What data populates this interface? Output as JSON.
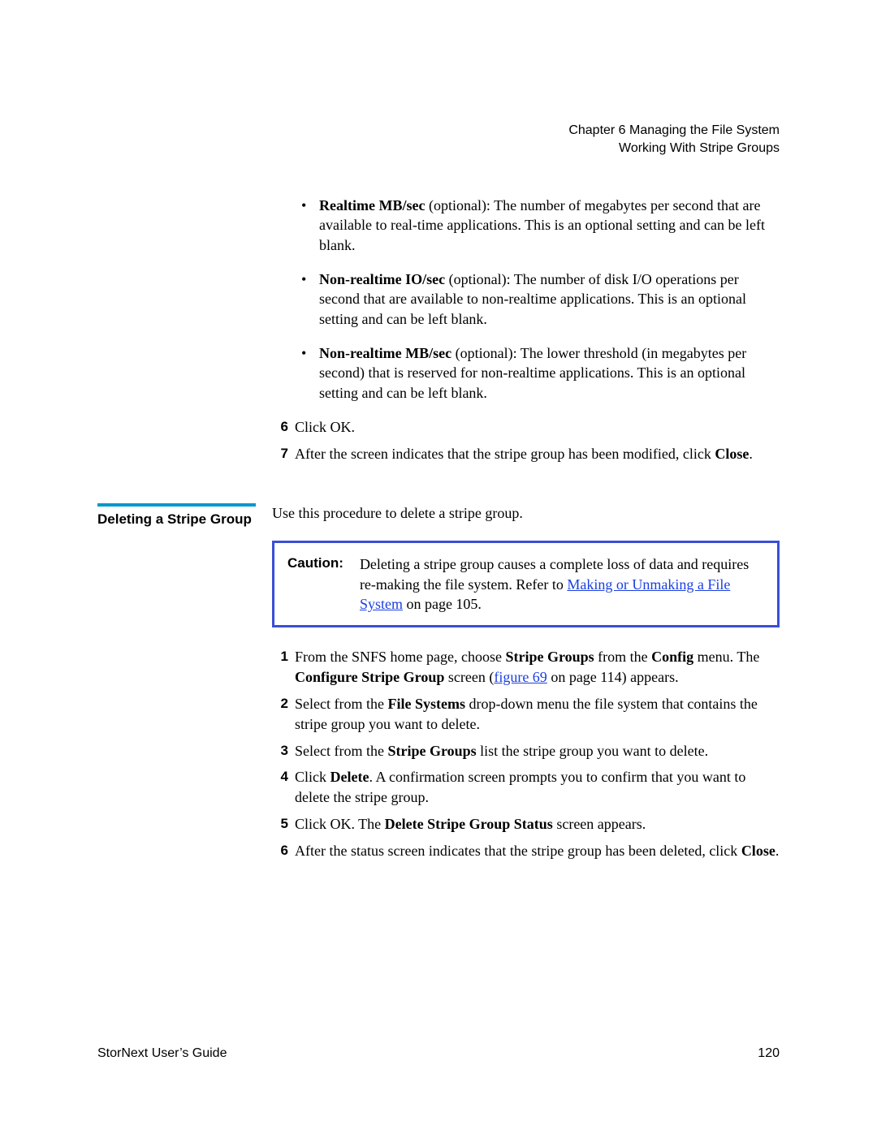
{
  "header": {
    "line1": "Chapter 6  Managing the File System",
    "line2": "Working With Stripe Groups"
  },
  "top_bullets": [
    {
      "bold": "Realtime MB/sec",
      "tail": " (optional): The number of megabytes per second that are available to real-time applications. This is an optional setting and can be left blank."
    },
    {
      "bold": "Non-realtime IO/sec",
      "tail": " (optional): The number of disk I/O operations per second that are available to non-realtime applications. This is an optional setting and can be left blank."
    },
    {
      "bold": "Non-realtime MB/sec",
      "tail": " (optional): The lower threshold (in megabytes per second) that is reserved for non-realtime applications. This is an optional setting and can be left blank."
    }
  ],
  "top_steps": {
    "six": {
      "num": "6",
      "text_pre": "Click OK."
    },
    "seven": {
      "num": "7",
      "text_pre": "After the screen indicates that the stripe group has been modified, click ",
      "bold1": "Close",
      "tail": "."
    }
  },
  "section": {
    "heading": "Deleting a Stripe Group",
    "intro": "Use this procedure to delete a stripe group.",
    "caution_label": "Caution:",
    "caution_text_pre": "Deleting a stripe group causes a complete loss of data and requires re-making the file system. Refer to ",
    "caution_link": "Making or Unmaking a File System",
    "caution_text_post": " on page  105."
  },
  "delete_steps": {
    "one": {
      "num": "1",
      "pre": "From the SNFS home page, choose ",
      "b1": "Stripe Groups",
      "mid1": " from the ",
      "b2": "Config",
      "mid2": " menu. The ",
      "b3": "Configure Stripe Group",
      "mid3": " screen (",
      "link": "figure 69",
      "post": " on page 114) appears."
    },
    "two": {
      "num": "2",
      "pre": "Select from the ",
      "b1": "File Systems",
      "post": " drop-down menu the file system that contains the stripe group you want to delete."
    },
    "three": {
      "num": "3",
      "pre": "Select from the ",
      "b1": "Stripe Groups",
      "post": " list the stripe group you want to delete."
    },
    "four": {
      "num": "4",
      "pre": "Click ",
      "b1": "Delete",
      "post": ". A confirmation screen prompts you to confirm that you want to delete the stripe group."
    },
    "five": {
      "num": "5",
      "pre": "Click OK. The ",
      "b1": "Delete Stripe Group Status",
      "post": " screen appears."
    },
    "six": {
      "num": "6",
      "pre": "After the status screen indicates that the stripe group has been deleted, click ",
      "b1": "Close",
      "post": "."
    }
  },
  "footer": {
    "left": "StorNext User’s Guide",
    "right": "120"
  }
}
